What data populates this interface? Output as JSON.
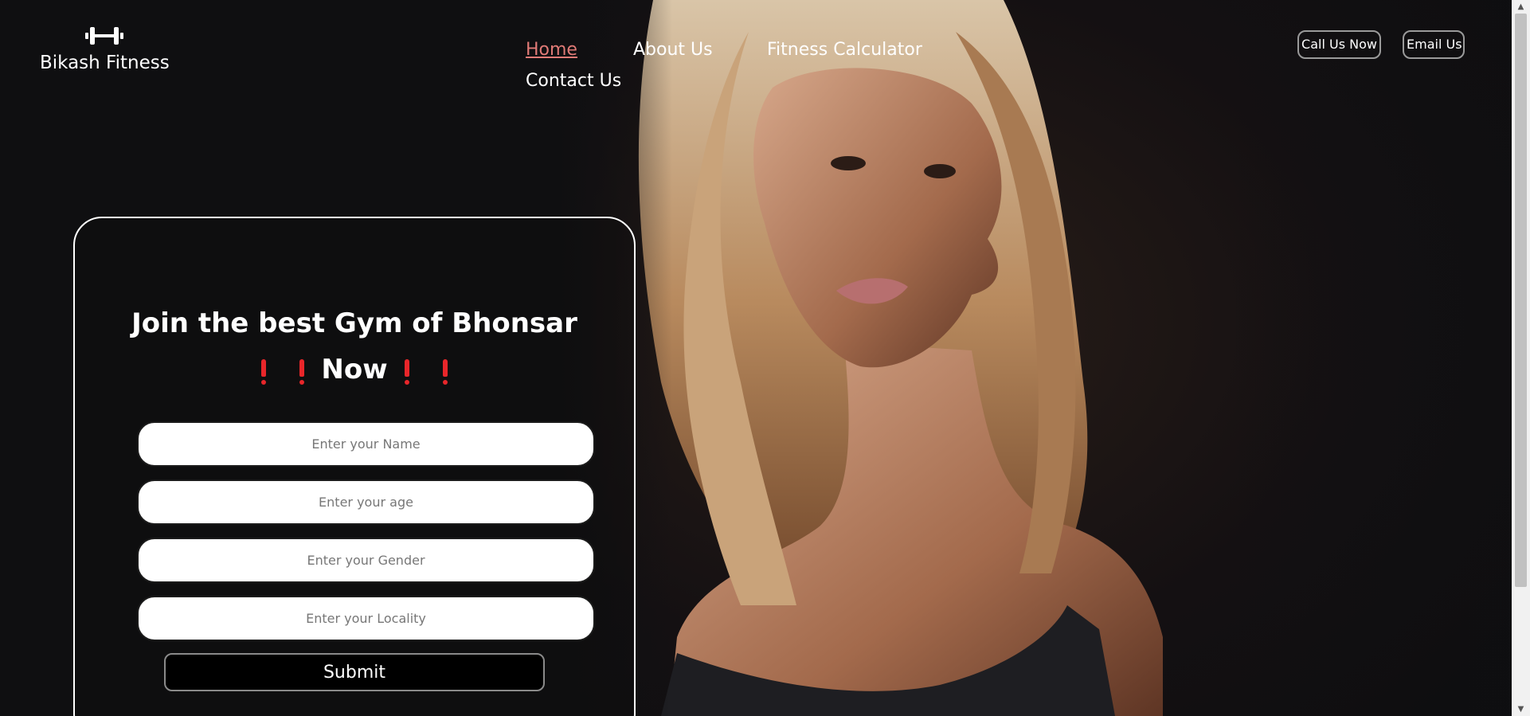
{
  "brand": {
    "logo_icon": "dumbbell-icon",
    "name": "Bikash Fitness"
  },
  "nav": {
    "home": "Home",
    "about": "About Us",
    "calculator": "Fitness Calculator",
    "contact": "Contact Us",
    "active_color": "#e07a76"
  },
  "header_buttons": {
    "call": "Call Us Now",
    "email": "Email Us"
  },
  "form": {
    "title": "Join the best Gym of Bhonsar",
    "subtitle_word": "Now",
    "exclamation_icon": "red-exclamation-icon",
    "exclamation_color": "#e8262a",
    "name_placeholder": "Enter your Name",
    "age_placeholder": "Enter your age",
    "gender_placeholder": "Enter your Gender",
    "locality_placeholder": "Enter your Locality",
    "submit_label": "Submit"
  },
  "colors": {
    "background": "#0f0f11",
    "text": "#ffffff"
  }
}
